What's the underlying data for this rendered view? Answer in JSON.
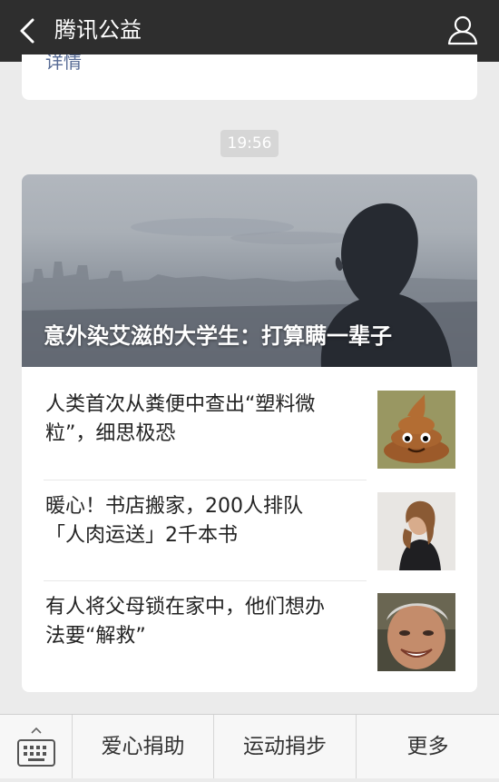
{
  "header": {
    "title": "腾讯公益",
    "back_icon": "chevron-left-icon",
    "profile_icon": "person-icon"
  },
  "previous_message": {
    "detail_link": "详情"
  },
  "timestamp": "19:56",
  "article": {
    "hero_title": "意外染艾滋的大学生：打算瞒一辈子",
    "items": [
      {
        "text": "人类首次从粪便中查出“塑料微粒”，细思极恐",
        "thumb_icon": "poop-emoji-icon"
      },
      {
        "text": "暖心！书店搬家，200人排队「人肉运送」2千本书",
        "thumb_icon": "portrait-photo"
      },
      {
        "text": "有人将父母锁在家中，他们想办法要“解救”",
        "thumb_icon": "elderly-woman-photo"
      }
    ]
  },
  "bottom_menu": {
    "keyboard_icon": "keyboard-icon",
    "items": [
      "爱心捐助",
      "运动捐步",
      "更多"
    ]
  },
  "colors": {
    "header_bg": "#2e2e2e",
    "page_bg": "#ebebeb",
    "link": "#576b95"
  }
}
